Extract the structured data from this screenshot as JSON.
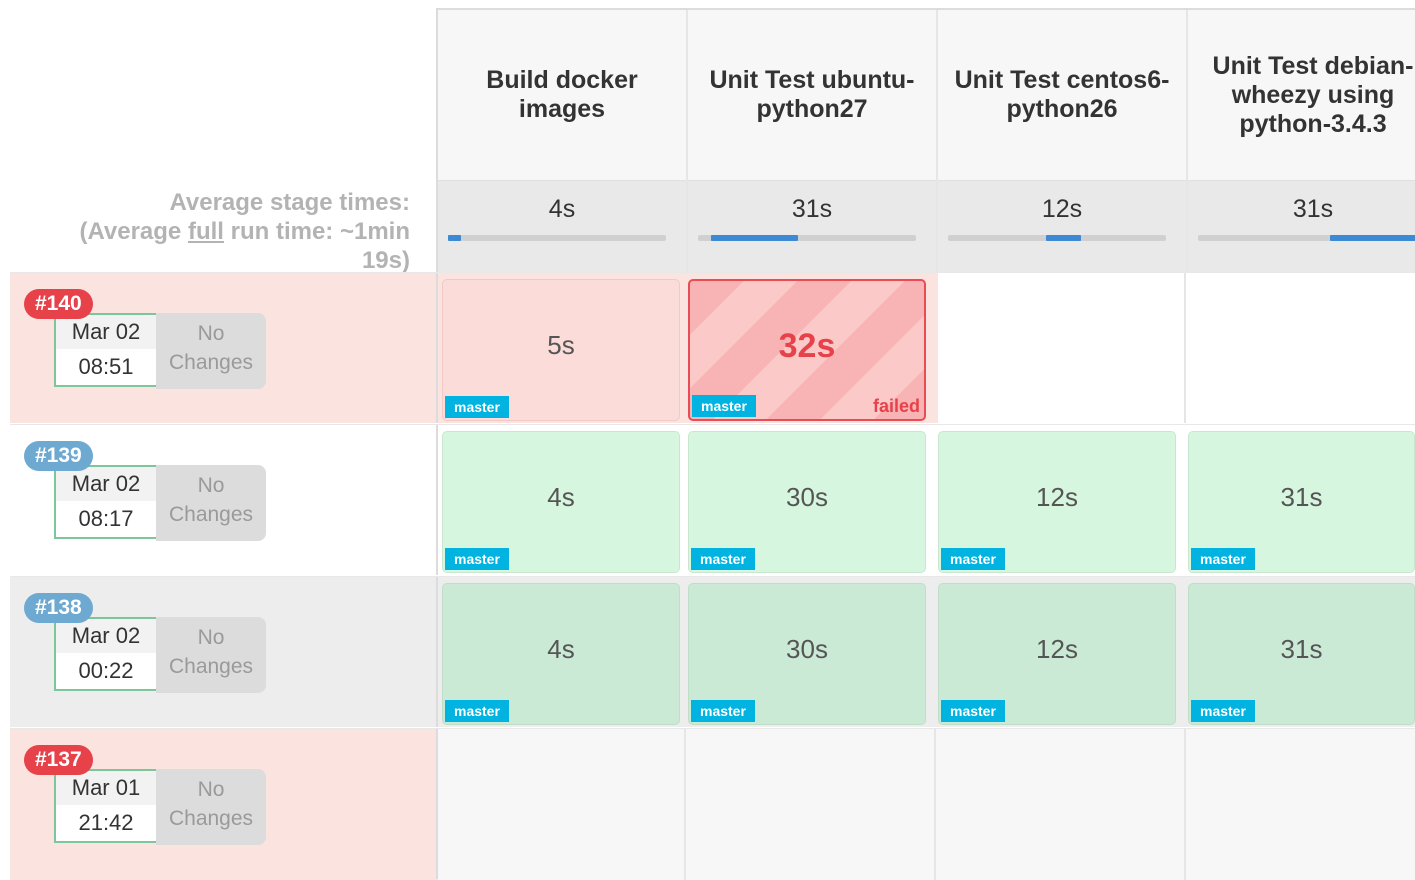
{
  "average": {
    "line1": "Average stage times:",
    "line2_prefix": "(Average ",
    "line2_underline": "full",
    "line2_suffix": " run time: ~1min",
    "line3": "19s)"
  },
  "stages": [
    {
      "name": "Build docker images",
      "avg": "4s",
      "bar_start": 0.0,
      "bar_fraction": 0.06
    },
    {
      "name": "Unit Test ubuntu-python27",
      "avg": "31s",
      "bar_start": 0.06,
      "bar_fraction": 0.4
    },
    {
      "name": "Unit Test centos6-python26",
      "avg": "12s",
      "bar_start": 0.45,
      "bar_fraction": 0.16
    },
    {
      "name": "Unit Test debian-wheezy using python-3.4.3",
      "avg": "31s",
      "bar_start": 0.6,
      "bar_fraction": 0.4
    }
  ],
  "builds": [
    {
      "number": "#140",
      "status": "failed",
      "date": "Mar 02",
      "time": "08:51",
      "changes_line1": "No",
      "changes_line2": "Changes",
      "cells": [
        {
          "time": "5s",
          "branch": "master"
        },
        {
          "time": "32s",
          "branch": "master",
          "status_label": "failed"
        }
      ]
    },
    {
      "number": "#139",
      "status": "success",
      "date": "Mar 02",
      "time": "08:17",
      "changes_line1": "No",
      "changes_line2": "Changes",
      "cells": [
        {
          "time": "4s",
          "branch": "master"
        },
        {
          "time": "30s",
          "branch": "master"
        },
        {
          "time": "12s",
          "branch": "master"
        },
        {
          "time": "31s",
          "branch": "master"
        }
      ]
    },
    {
      "number": "#138",
      "status": "success",
      "date": "Mar 02",
      "time": "00:22",
      "changes_line1": "No",
      "changes_line2": "Changes",
      "cells": [
        {
          "time": "4s",
          "branch": "master"
        },
        {
          "time": "30s",
          "branch": "master"
        },
        {
          "time": "12s",
          "branch": "master"
        },
        {
          "time": "31s",
          "branch": "master"
        }
      ]
    },
    {
      "number": "#137",
      "status": "failed",
      "date": "Mar 01",
      "time": "21:42",
      "changes_line1": "No",
      "changes_line2": "Changes",
      "cells": []
    }
  ],
  "colors": {
    "failed_badge": "#e7414a",
    "success_badge": "#6ea9d2",
    "branch_tag": "#00b3e0",
    "progress_bar": "#3c8ad3"
  }
}
